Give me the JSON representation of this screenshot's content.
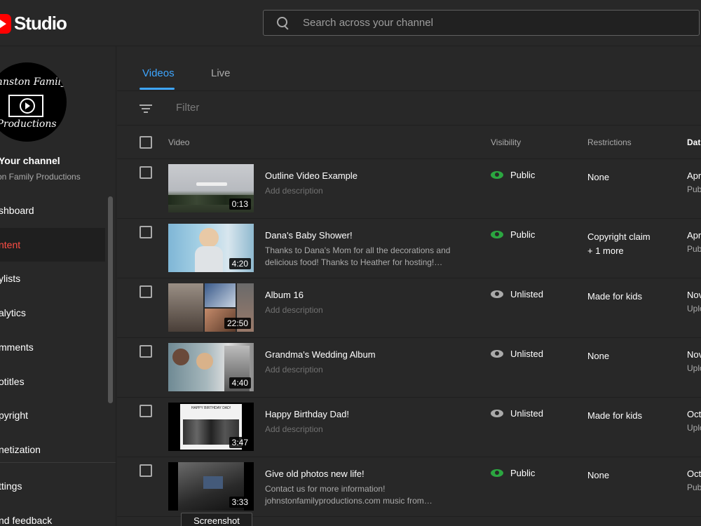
{
  "header": {
    "logo_text": "Studio",
    "search_placeholder": "Search across your channel"
  },
  "sidebar": {
    "avatar_lines": [
      "Johnston Family",
      "Productions"
    ],
    "channel_title": "Your channel",
    "channel_name": "on Family Productions",
    "items": [
      {
        "label": "shboard"
      },
      {
        "label": "ntent"
      },
      {
        "label": "ylists"
      },
      {
        "label": "alytics"
      },
      {
        "label": "mments"
      },
      {
        "label": "otitles"
      },
      {
        "label": "pyright"
      },
      {
        "label": "netization"
      },
      {
        "label": "ttings"
      },
      {
        "label": "nd feedback"
      }
    ]
  },
  "tabs": [
    {
      "label": "Videos"
    },
    {
      "label": "Live"
    }
  ],
  "filter": {
    "placeholder": "Filter"
  },
  "table": {
    "headers": {
      "video": "Video",
      "visibility": "Visibility",
      "restrictions": "Restrictions",
      "date": "Dat"
    },
    "rows": [
      {
        "title": "Outline Video Example",
        "description": "Add description",
        "duration": "0:13",
        "visibility": "Public",
        "restriction_1": "None",
        "restriction_2": "",
        "date": "Apr",
        "date_status": "Pub"
      },
      {
        "title": "Dana's Baby Shower!",
        "description": "Thanks to Dana's Mom for all the decorations and delicious food! Thanks to Heather for hosting!…",
        "duration": "4:20",
        "visibility": "Public",
        "restriction_1": "Copyright claim",
        "restriction_2": "+ 1 more",
        "date": "Apr",
        "date_status": "Pub"
      },
      {
        "title": "Album 16",
        "description": "Add description",
        "duration": "22:50",
        "visibility": "Unlisted",
        "restriction_1": "Made for kids",
        "restriction_2": "",
        "date": "Nov",
        "date_status": "Uplo"
      },
      {
        "title": "Grandma's Wedding Album",
        "description": "Add description",
        "duration": "4:40",
        "visibility": "Unlisted",
        "restriction_1": "None",
        "restriction_2": "",
        "date": "Nov",
        "date_status": "Uplo"
      },
      {
        "title": "Happy Birthday Dad!",
        "description": "Add description",
        "duration": "3:47",
        "visibility": "Unlisted",
        "restriction_1": "Made for kids",
        "restriction_2": "",
        "date": "Oct",
        "date_status": "Uplo",
        "thumb_caption": "HAPPY BIRTHDAY DAD!"
      },
      {
        "title": "Give old photos new life!",
        "description": "Contact us for more information! johnstonfamilyproductions.com music from…",
        "duration": "3:33",
        "visibility": "Public",
        "restriction_1": "None",
        "restriction_2": "",
        "date": "Oct",
        "date_status": "Pub"
      }
    ]
  },
  "tooltip": {
    "label": "Screenshot"
  },
  "colors": {
    "public": "#2ba640",
    "unlisted": "#aaaaaa",
    "accent": "#3ea6ff",
    "active_nav": "#ff4e45",
    "brand": "#ff0000"
  }
}
